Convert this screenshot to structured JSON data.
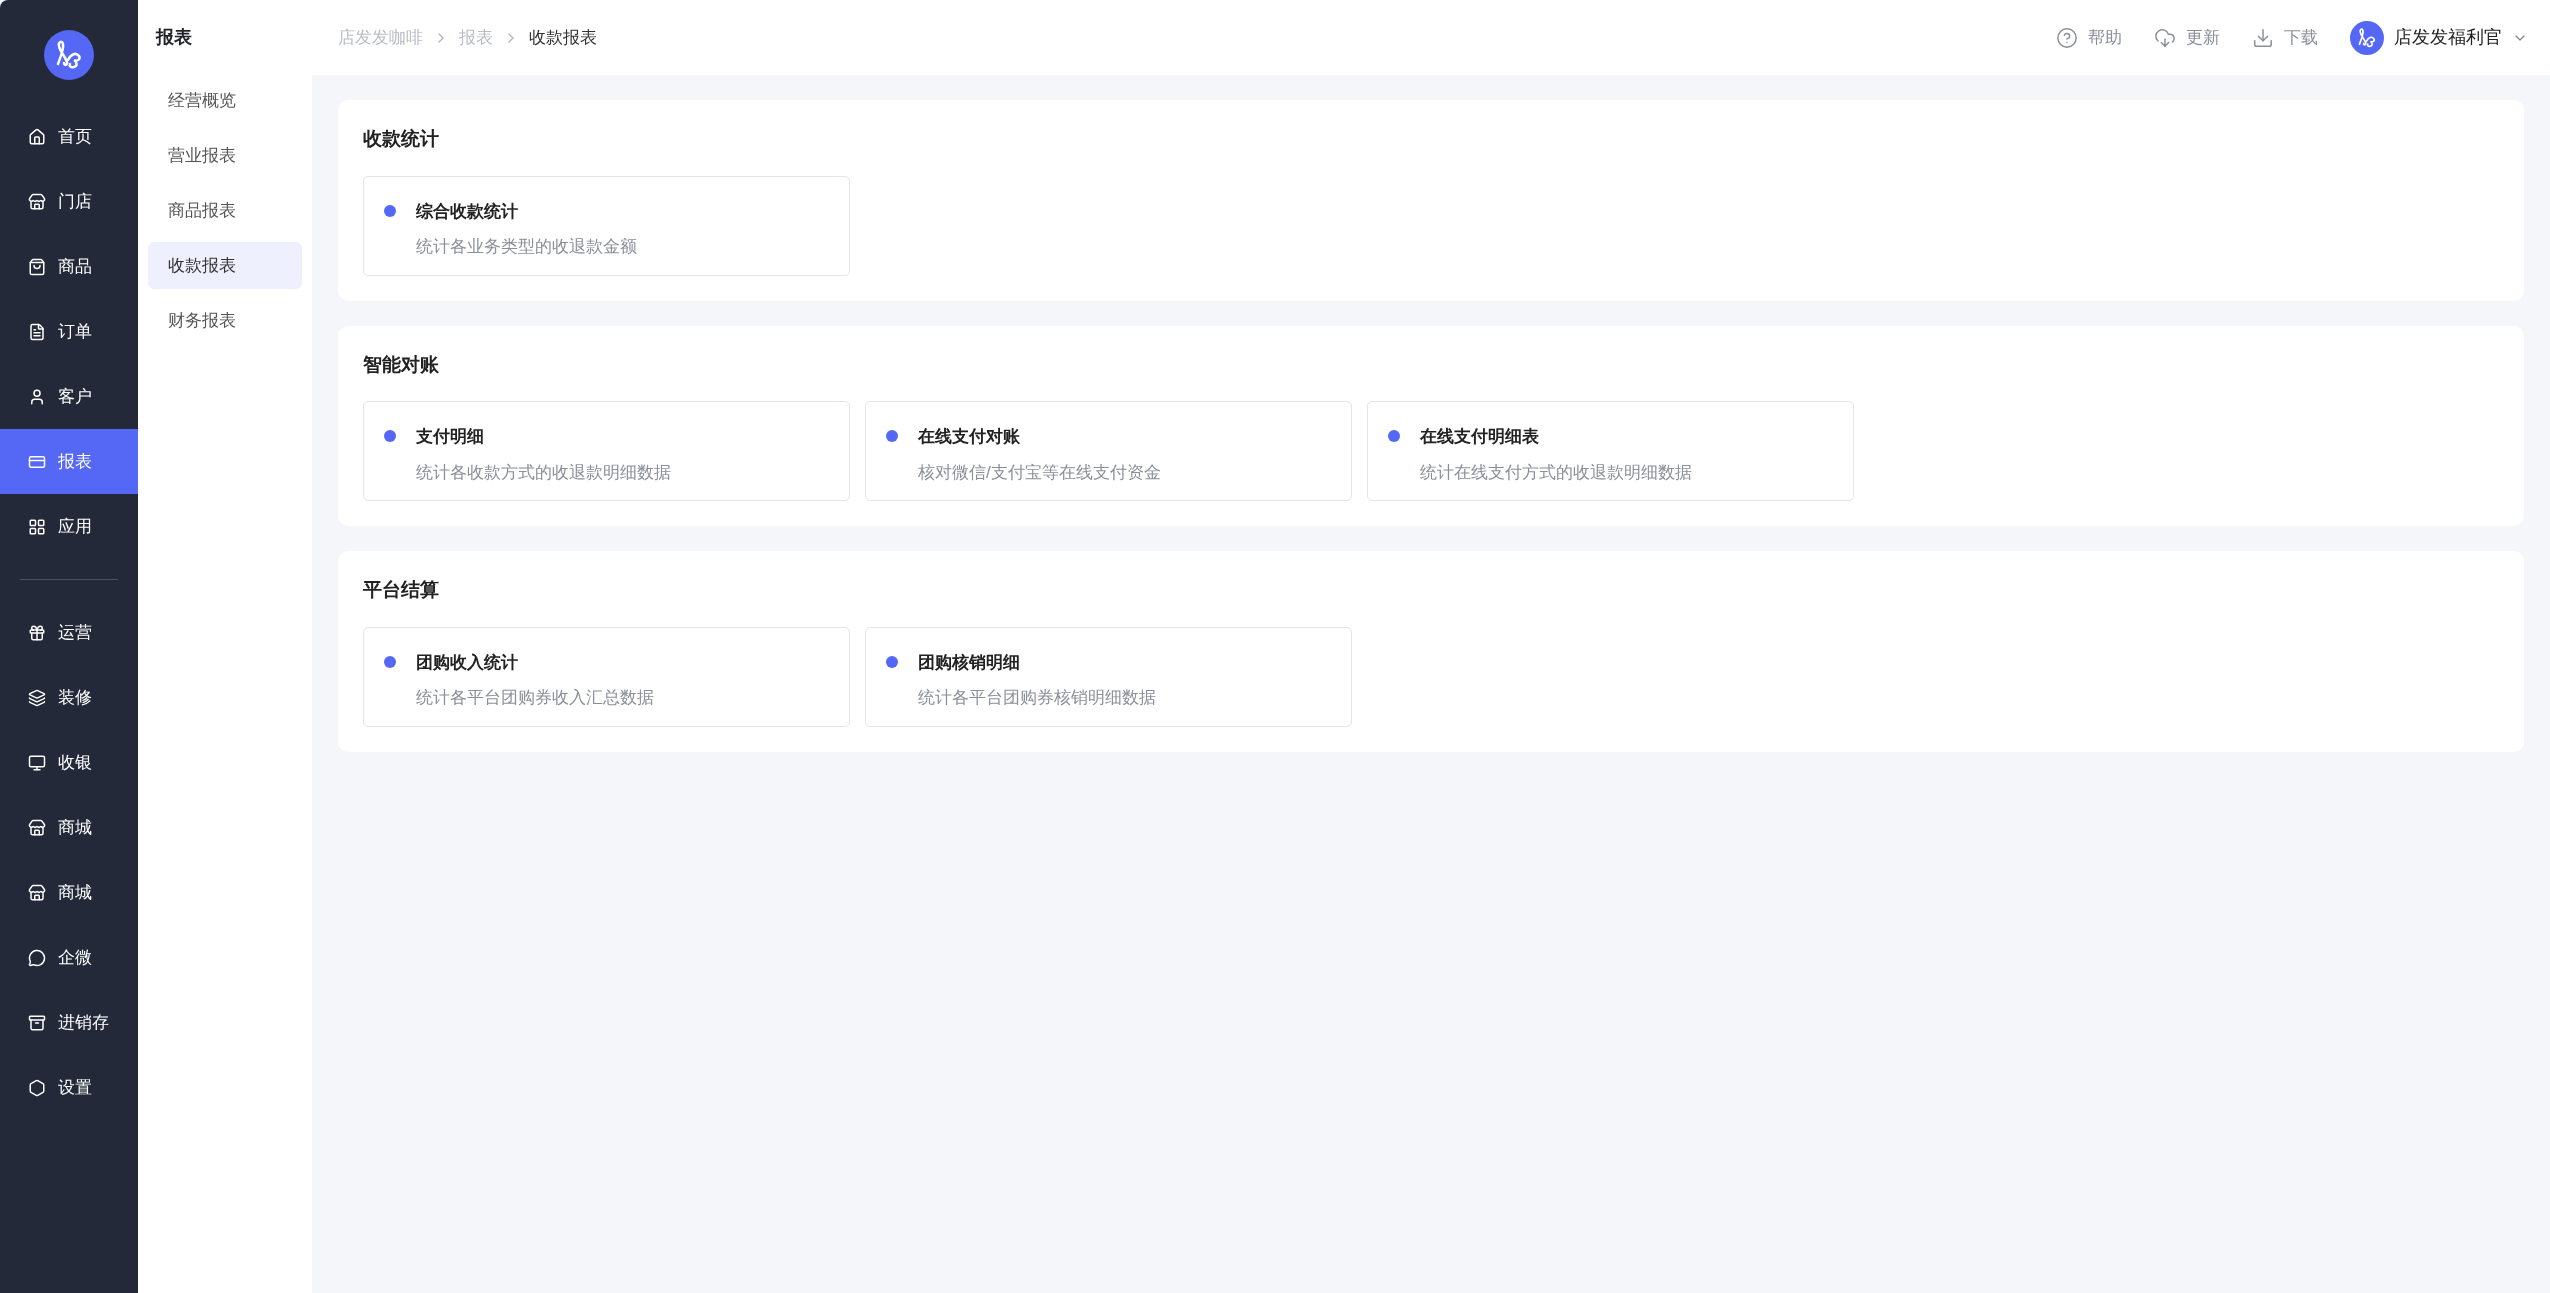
{
  "main_nav": {
    "groups": [
      {
        "items": [
          {
            "label": "首页",
            "selected": false
          },
          {
            "label": "门店",
            "selected": false
          },
          {
            "label": "商品",
            "selected": false
          },
          {
            "label": "订单",
            "selected": false
          },
          {
            "label": "客户",
            "selected": false
          },
          {
            "label": "报表",
            "selected": true
          },
          {
            "label": "应用",
            "selected": false
          }
        ]
      },
      {
        "items": [
          {
            "label": "运营",
            "selected": false
          },
          {
            "label": "装修",
            "selected": false
          },
          {
            "label": "收银",
            "selected": false
          },
          {
            "label": "商城",
            "selected": false
          },
          {
            "label": "商城",
            "selected": false
          },
          {
            "label": "企微",
            "selected": false
          },
          {
            "label": "进销存",
            "selected": false
          },
          {
            "label": "设置",
            "selected": false
          }
        ]
      }
    ]
  },
  "sub_nav": {
    "title": "报表",
    "items": [
      {
        "label": "经营概览",
        "selected": false
      },
      {
        "label": "营业报表",
        "selected": false
      },
      {
        "label": "商品报表",
        "selected": false
      },
      {
        "label": "收款报表",
        "selected": true
      },
      {
        "label": "财务报表",
        "selected": false
      }
    ]
  },
  "breadcrumb": [
    "店发发咖啡",
    "报表",
    "收款报表"
  ],
  "header_actions": [
    "帮助",
    "更新",
    "下载"
  ],
  "user": {
    "name": "店发发福利官"
  },
  "sections": [
    {
      "title": "收款统计",
      "cards": [
        {
          "title": "综合收款统计",
          "description": "统计各业务类型的收退款金额"
        }
      ]
    },
    {
      "title": "智能对账",
      "cards": [
        {
          "title": "支付明细",
          "description": "统计各收款方式的收退款明细数据"
        },
        {
          "title": "在线支付对账",
          "description": "核对微信/支付宝等在线支付资金"
        },
        {
          "title": "在线支付明细表",
          "description": "统计在线支付方式的收退款明细数据"
        }
      ]
    },
    {
      "title": "平台结算",
      "cards": [
        {
          "title": "团购收入统计",
          "description": "统计各平台团购券收入汇总数据"
        },
        {
          "title": "团购核销明细",
          "description": "统计各平台团购券核销明细数据"
        }
      ]
    }
  ]
}
